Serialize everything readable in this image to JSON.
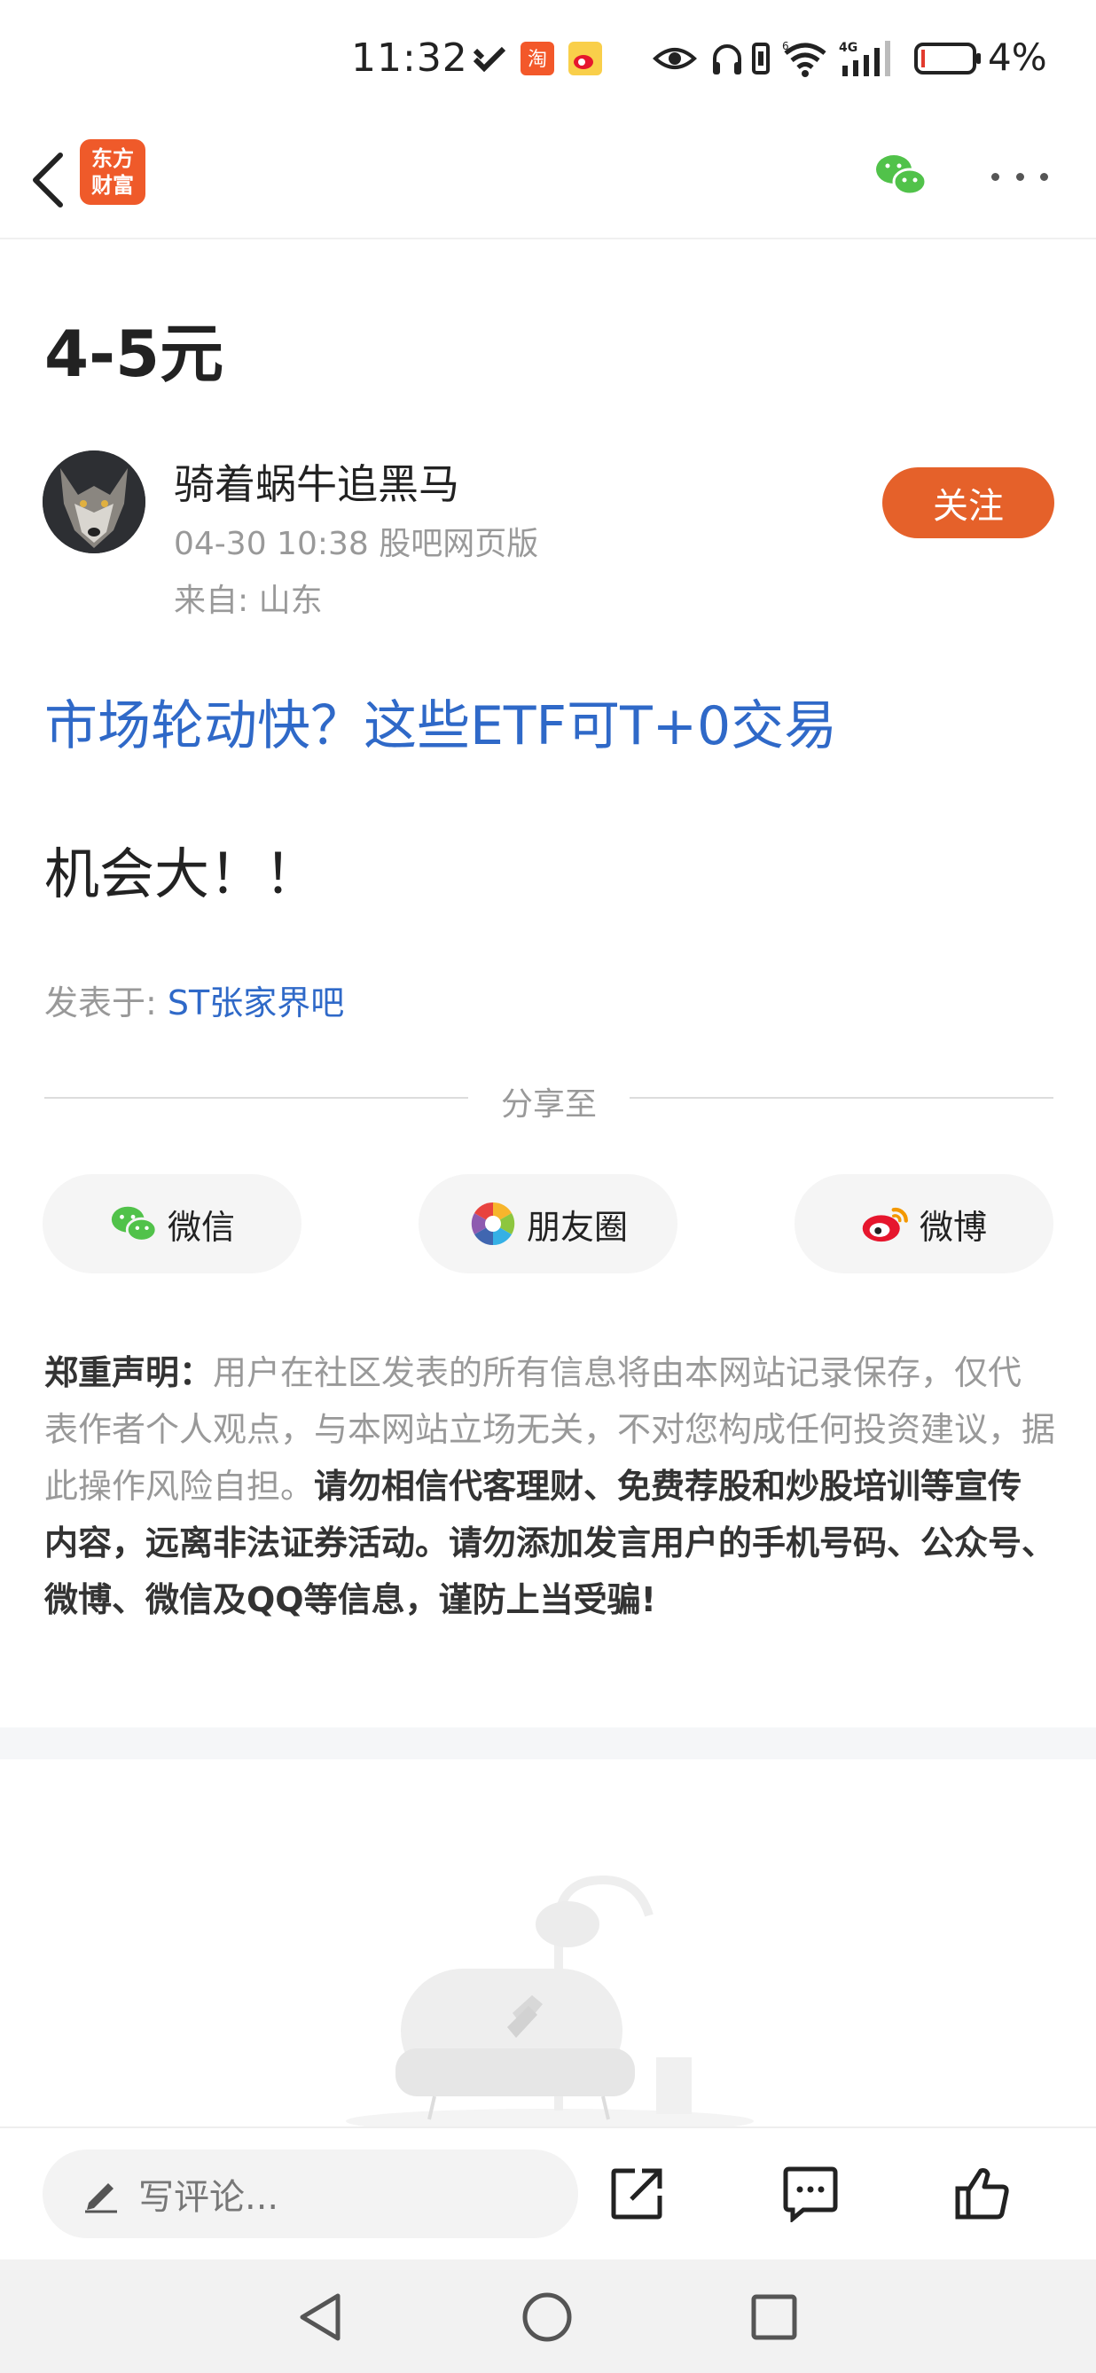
{
  "status_bar": {
    "time": "11:32",
    "battery": "4%",
    "network": "4G",
    "icons": [
      "check-mark-icon",
      "taobao-app-icon",
      "weibo-app-icon",
      "eye-icon",
      "headphone-icon",
      "vibrate-icon",
      "wifi-icon",
      "signal-icon",
      "battery-icon"
    ]
  },
  "nav": {
    "logo_line1": "东方",
    "logo_line2": "财富",
    "icons": [
      "back-arrow-icon",
      "wechat-icon",
      "more-icon"
    ]
  },
  "post": {
    "title": "4-5元",
    "author": "骑着蜗牛追黑马",
    "meta": "04-30 10:38 股吧网页版",
    "origin": "来自: 山东",
    "follow_label": "关注",
    "promo_link": "市场轮动快？这些ETF可T+0交易",
    "body": "机会大！！",
    "posted_in_prefix": "发表于: ",
    "forum": "ST张家界吧"
  },
  "share": {
    "label": "分享至",
    "buttons": [
      {
        "label": "微信",
        "icon": "wechat-icon"
      },
      {
        "label": "朋友圈",
        "icon": "moments-icon"
      },
      {
        "label": "微博",
        "icon": "weibo-icon"
      }
    ]
  },
  "disclaimer": {
    "heading": "郑重声明：",
    "normal": "用户在社区发表的所有信息将由本网站记录保存，仅代表作者个人观点，与本网站立场无关，不对您构成任何投资建议，据此操作风险自担。",
    "strong": "请勿相信代客理财、免费荐股和炒股培训等宣传内容，远离非法证券活动。请勿添加发言用户的手机号码、公众号、微博、微信及QQ等信息，谨防上当受骗!"
  },
  "action_bar": {
    "comment_placeholder": "写评论...",
    "icons": [
      "share-icon",
      "comment-icon",
      "like-icon"
    ]
  },
  "colors": {
    "accent": "#e5612a",
    "link": "#2f69c8",
    "muted": "#999999"
  }
}
